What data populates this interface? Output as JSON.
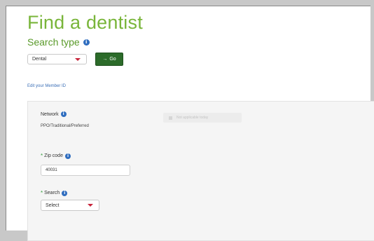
{
  "page": {
    "title": "Find a dentist"
  },
  "search_type": {
    "label": "Search type",
    "selected": "Dental",
    "go_label": "Go",
    "go_icon": "arrow-right-icon"
  },
  "edit_member_id": "Edit your Member ID",
  "network": {
    "label": "Network",
    "value": "PPO/Traditional/Preferred",
    "placeholder": "Not applicable today"
  },
  "zip_code": {
    "label": "Zip code",
    "value": "40031"
  },
  "search": {
    "label": "Search",
    "selected": "Select"
  },
  "colors": {
    "title_green": "#79b53a",
    "go_button": "#2c6b2a",
    "info_icon": "#2f6dbf",
    "caret_red": "#c8243a",
    "link_blue": "#3b6fb6"
  }
}
